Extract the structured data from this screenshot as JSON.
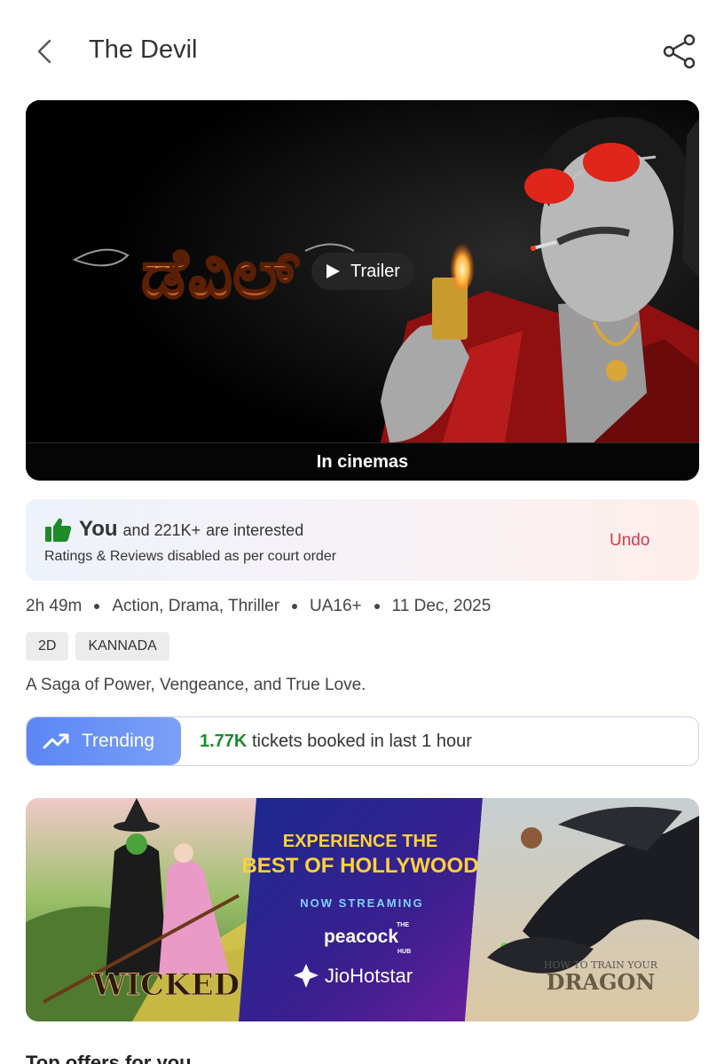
{
  "header": {
    "title": "The Devil"
  },
  "trailer": {
    "logo_text": "ಡೆವಿಲ್",
    "play_label": "Trailer",
    "availability": "In cinemas"
  },
  "interest": {
    "you": "You",
    "count": "and 221K+",
    "suffix": "are interested",
    "note": "Ratings & Reviews disabled as per court order",
    "undo": "Undo"
  },
  "meta": {
    "duration": "2h 49m",
    "genres": "Action, Drama, Thriller",
    "certificate": "UA16+",
    "release_date": "11 Dec, 2025"
  },
  "tags": [
    "2D",
    "KANNADA"
  ],
  "tagline": "A Saga of Power, Vengeance, and True Love.",
  "trending": {
    "label": "Trending",
    "count": "1.77K",
    "text": "tickets booked in last 1 hour"
  },
  "ad": {
    "left_title": "WICKED",
    "headline_1": "EXPERIENCE THE",
    "headline_2": "BEST OF HOLLYWOOD",
    "subhead": "NOW STREAMING",
    "brand_small": "THE",
    "brand": "peacock",
    "brand_hub": "HUB",
    "platform": "JioHotstar",
    "right_title_1": "HOW TO TRAIN YOUR",
    "right_title_2": "DRAGON"
  },
  "section": {
    "offers_title": "Top offers for you"
  },
  "colors": {
    "undo": "#d6374e",
    "trending_count": "#1c8a2e",
    "trending_pill": "#5b86f5",
    "thumb": "#1f8a2a"
  }
}
